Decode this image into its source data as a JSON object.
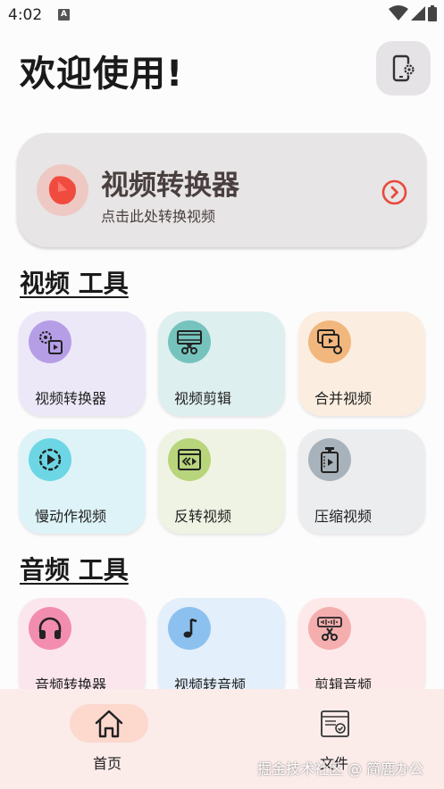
{
  "status": {
    "time": "4:02",
    "notif_icon": "A"
  },
  "header": {
    "title": "欢迎使用!"
  },
  "hero": {
    "title": "视频转换器",
    "subtitle": "点击此处转换视频"
  },
  "video_section": {
    "title": "视频 工具",
    "tiles": [
      {
        "label": "视频转换器",
        "icon": "video-settings-icon",
        "bg": "#ece8f8",
        "icon_bg": "#b59ee6"
      },
      {
        "label": "视频剪辑",
        "icon": "film-scissors-icon",
        "bg": "#deefef",
        "icon_bg": "#76c3bd"
      },
      {
        "label": "合并视频",
        "icon": "merge-video-icon",
        "bg": "#fbeee0",
        "icon_bg": "#f2b77d"
      },
      {
        "label": "慢动作视频",
        "icon": "slow-motion-icon",
        "bg": "#ddf3f7",
        "icon_bg": "#6cd6e4"
      },
      {
        "label": "反转视频",
        "icon": "reverse-video-icon",
        "bg": "#eff3e3",
        "icon_bg": "#b8d57c"
      },
      {
        "label": "压缩视频",
        "icon": "compress-video-icon",
        "bg": "#ebedef",
        "icon_bg": "#a8b2ba"
      }
    ]
  },
  "audio_section": {
    "title": "音频 工具",
    "tiles": [
      {
        "label": "音频转换器",
        "icon": "headphones-icon",
        "bg": "#fce6ee",
        "icon_bg": "#f38db0"
      },
      {
        "label": "视频转音频",
        "icon": "music-note-icon",
        "bg": "#e3effb",
        "icon_bg": "#8cc1ef"
      },
      {
        "label": "剪辑音频",
        "icon": "audio-cut-icon",
        "bg": "#fde9e9",
        "icon_bg": "#f4aeae"
      }
    ]
  },
  "bottom_nav": {
    "home_label": "首页",
    "files_label": "文件"
  },
  "watermark": "掘金技术社区 @ 简鹿办公"
}
